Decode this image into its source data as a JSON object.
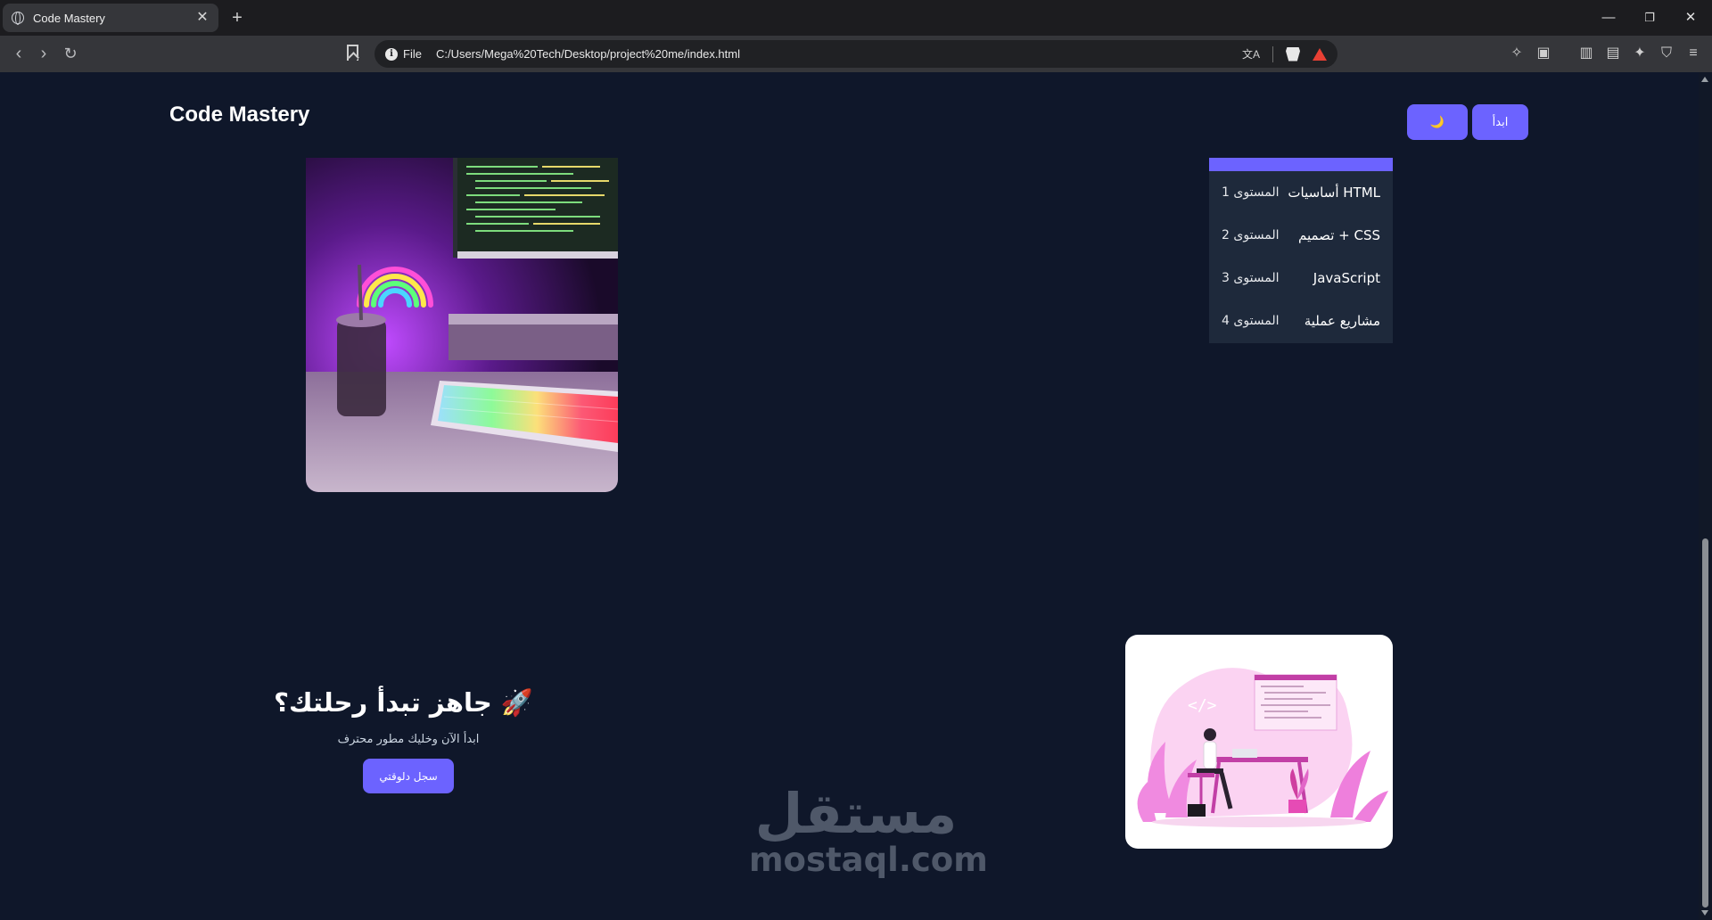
{
  "browser": {
    "tab_title": "Code Mastery",
    "tab_close": "✕",
    "new_tab": "+",
    "minimize": "—",
    "restore": "❐",
    "close": "✕",
    "address_scheme": "File",
    "address_url": "C:/Users/Mega%20Tech/Desktop/project%20me/index.html",
    "translate_icon": "文A"
  },
  "header": {
    "logo": "Code Mastery",
    "start_button": "ابدأ",
    "theme_toggle": "🌙"
  },
  "levels": [
    {
      "name": "أساسيات HTML",
      "level": "المستوى 1"
    },
    {
      "name": "تصميم + CSS",
      "level": "المستوى 2"
    },
    {
      "name": "JavaScript",
      "level": "المستوى 3"
    },
    {
      "name": "مشاريع عملية",
      "level": "المستوى 4"
    }
  ],
  "cta": {
    "title": "🚀 جاهز تبدأ رحلتك؟",
    "subtitle": "ابدأ الآن وخليك مطور محترف",
    "button": "سجل دلوقتي"
  },
  "watermark": {
    "arabic": "مستقل",
    "latin": "mostaql.com"
  },
  "colors": {
    "page_bg": "#0f172a",
    "accent": "#6c63ff",
    "card_bg": "#1e293b"
  }
}
